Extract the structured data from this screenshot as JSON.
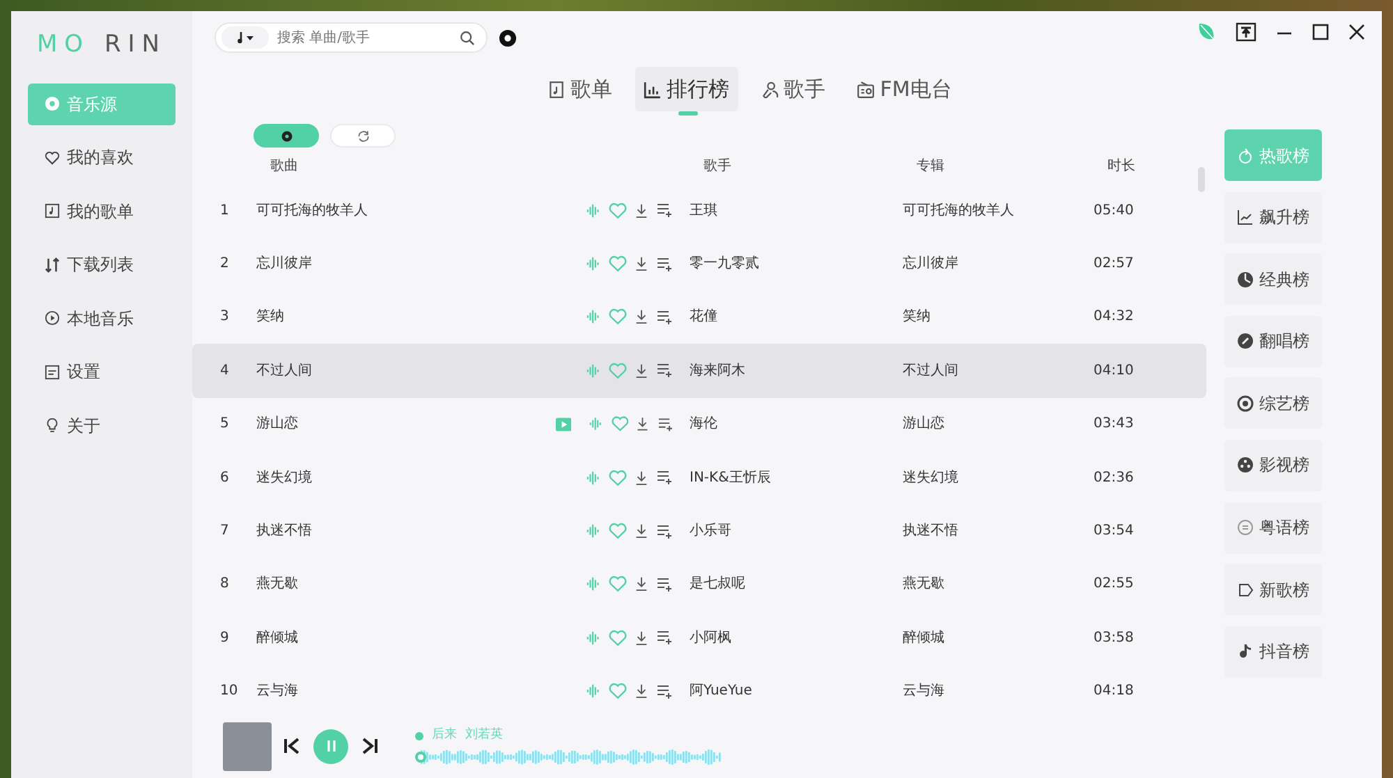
{
  "app": {
    "logo_left": "MO",
    "logo_right": "RIN"
  },
  "sidebar": {
    "items": [
      {
        "label": "音乐源",
        "selected": true
      },
      {
        "label": "我的喜欢",
        "selected": false
      },
      {
        "label": "我的歌单",
        "selected": false
      },
      {
        "label": "下载列表",
        "selected": false
      },
      {
        "label": "本地音乐",
        "selected": false
      },
      {
        "label": "设置",
        "selected": false
      },
      {
        "label": "关于",
        "selected": false
      }
    ]
  },
  "search": {
    "placeholder": "搜索 单曲/歌手"
  },
  "tabs": [
    {
      "label": "歌单",
      "selected": false
    },
    {
      "label": "排行榜",
      "selected": true
    },
    {
      "label": "歌手",
      "selected": false
    },
    {
      "label": "FM电台",
      "selected": false
    }
  ],
  "toggles": [
    {
      "selected": true
    },
    {
      "selected": false
    }
  ],
  "table": {
    "columns": [
      "歌曲",
      "歌手",
      "专辑",
      "时长"
    ],
    "rows": [
      {
        "index": "1",
        "title": "可可托海的牧羊人",
        "mv": false,
        "artist": "王琪",
        "album": "可可托海的牧羊人",
        "duration": "05:40",
        "selected": false
      },
      {
        "index": "2",
        "title": "忘川彼岸",
        "mv": false,
        "artist": "零一九零贰",
        "album": "忘川彼岸",
        "duration": "02:57",
        "selected": false
      },
      {
        "index": "3",
        "title": "笑纳",
        "mv": false,
        "artist": "花僮",
        "album": "笑纳",
        "duration": "04:32",
        "selected": false
      },
      {
        "index": "4",
        "title": "不过人间",
        "mv": false,
        "artist": "海来阿木",
        "album": "不过人间",
        "duration": "04:10",
        "selected": true
      },
      {
        "index": "5",
        "title": "游山恋",
        "mv": true,
        "artist": "海伦",
        "album": "游山恋",
        "duration": "03:43",
        "selected": false
      },
      {
        "index": "6",
        "title": "迷失幻境",
        "mv": false,
        "artist": "IN-K&王忻辰",
        "album": "迷失幻境",
        "duration": "02:36",
        "selected": false
      },
      {
        "index": "7",
        "title": "执迷不悟",
        "mv": false,
        "artist": "小乐哥",
        "album": "执迷不悟",
        "duration": "03:54",
        "selected": false
      },
      {
        "index": "8",
        "title": "燕无歇",
        "mv": false,
        "artist": "是七叔呢",
        "album": "燕无歇",
        "duration": "02:55",
        "selected": false
      },
      {
        "index": "9",
        "title": "醉倾城",
        "mv": false,
        "artist": "小阿枫",
        "album": "醉倾城",
        "duration": "03:58",
        "selected": false
      },
      {
        "index": "10",
        "title": "云与海",
        "mv": false,
        "artist": "阿YueYue",
        "album": "云与海",
        "duration": "04:18",
        "selected": false
      }
    ]
  },
  "charts": [
    {
      "label": "热歌榜",
      "selected": true
    },
    {
      "label": "飙升榜",
      "selected": false
    },
    {
      "label": "经典榜",
      "selected": false
    },
    {
      "label": "翻唱榜",
      "selected": false
    },
    {
      "label": "综艺榜",
      "selected": false
    },
    {
      "label": "影视榜",
      "selected": false
    },
    {
      "label": "粤语榜",
      "selected": false
    },
    {
      "label": "新歌榜",
      "selected": false
    },
    {
      "label": "抖音榜",
      "selected": false
    }
  ],
  "player": {
    "title": "后来",
    "artist": "刘若英",
    "playing": true
  }
}
